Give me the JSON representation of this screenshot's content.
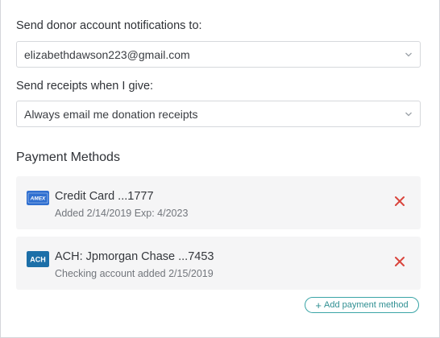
{
  "notifications": {
    "label": "Send donor account notifications to:",
    "selected": "elizabethdawson223@gmail.com",
    "chevron_icon": "chevron-down-icon"
  },
  "receipts": {
    "label": "Send receipts when I give:",
    "selected": "Always email me donation receipts",
    "chevron_icon": "chevron-down-icon"
  },
  "payment_methods": {
    "title": "Payment Methods",
    "items": [
      {
        "badge_text": "AMEX",
        "badge_color": "#2f6fd0",
        "title": "Credit Card ...1777",
        "subtitle": "Added 2/14/2019 Exp: 4/2023",
        "remove_icon": "close-icon"
      },
      {
        "badge_text": "ACH",
        "badge_color": "#1c6fa8",
        "title": "ACH: Jpmorgan Chase ...7453",
        "subtitle": "Checking account added 2/15/2019",
        "remove_icon": "close-icon"
      }
    ],
    "add_button": {
      "plus": "+",
      "label": "Add payment method"
    }
  },
  "colors": {
    "accent": "#3ba5a7",
    "remove": "#d9453d",
    "card_bg": "#f5f5f6"
  }
}
